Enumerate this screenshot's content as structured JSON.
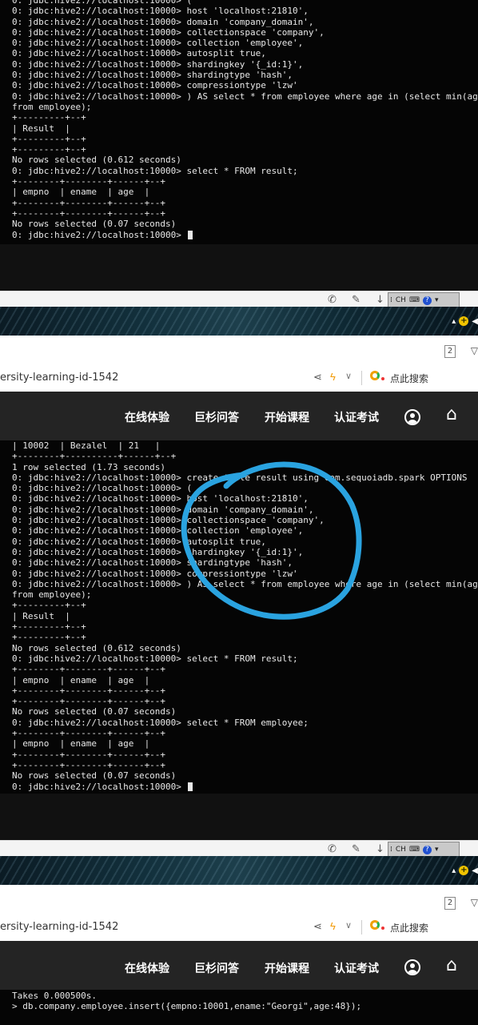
{
  "screenshot_1": {
    "terminal_lines": [
      "0: jdbc:hive2://localhost:10000> (",
      "0: jdbc:hive2://localhost:10000> host 'localhost:21810',",
      "0: jdbc:hive2://localhost:10000> domain 'company_domain',",
      "0: jdbc:hive2://localhost:10000> collectionspace 'company',",
      "0: jdbc:hive2://localhost:10000> collection 'employee',",
      "0: jdbc:hive2://localhost:10000> autosplit true,",
      "0: jdbc:hive2://localhost:10000> shardingkey '{_id:1}',",
      "0: jdbc:hive2://localhost:10000> shardingtype 'hash',",
      "0: jdbc:hive2://localhost:10000> compressiontype 'lzw'",
      "0: jdbc:hive2://localhost:10000> ) AS select * from employee where age in (select min(age)",
      "from employee);",
      "+---------+--+",
      "| Result  |",
      "+---------+--+",
      "+---------+--+",
      "No rows selected (0.612 seconds)",
      "0: jdbc:hive2://localhost:10000> select * FROM result;",
      "+--------+--------+------+--+",
      "| empno  | ename  | age  |",
      "+--------+--------+------+--+",
      "+--------+--------+------+--+",
      "No rows selected (0.07 seconds)",
      "0: jdbc:hive2://localhost:10000> "
    ],
    "taskbar": {
      "ime_lang": "CH",
      "ime_help": "?"
    }
  },
  "screenshot_2": {
    "tab_count": "2",
    "url_fragment": "ersity-learning-id-1542",
    "search_label": "点此搜索",
    "nav_items": [
      "在线体验",
      "巨杉问答",
      "开始课程",
      "认证考试"
    ],
    "terminal_lines": [
      "| 10002  | Bezalel  | 21   |",
      "+--------+----------+------+--+",
      "1 row selected (1.73 seconds)",
      "0: jdbc:hive2://localhost:10000> create table result using com.sequoiadb.spark OPTIONS",
      "0: jdbc:hive2://localhost:10000> (",
      "0: jdbc:hive2://localhost:10000> host 'localhost:21810',",
      "0: jdbc:hive2://localhost:10000> domain 'company_domain',",
      "0: jdbc:hive2://localhost:10000> collectionspace 'company',",
      "0: jdbc:hive2://localhost:10000> collection 'employee',",
      "0: jdbc:hive2://localhost:10000> autosplit true,",
      "0: jdbc:hive2://localhost:10000> shardingkey '{_id:1}',",
      "0: jdbc:hive2://localhost:10000> shardingtype 'hash',",
      "0: jdbc:hive2://localhost:10000> compressiontype 'lzw'",
      "0: jdbc:hive2://localhost:10000> ) AS select * from employee where age in (select min(age)",
      "from employee);",
      "+---------+--+",
      "| Result  |",
      "+---------+--+",
      "+---------+--+",
      "No rows selected (0.612 seconds)",
      "0: jdbc:hive2://localhost:10000> select * FROM result;",
      "+--------+--------+------+--+",
      "| empno  | ename  | age  |",
      "+--------+--------+------+--+",
      "+--------+--------+------+--+",
      "No rows selected (0.07 seconds)",
      "0: jdbc:hive2://localhost:10000> select * FROM employee;",
      "+--------+--------+------+--+",
      "| empno  | ename  | age  |",
      "+--------+--------+------+--+",
      "+--------+--------+------+--+",
      "No rows selected (0.07 seconds)",
      "0: jdbc:hive2://localhost:10000> "
    ],
    "taskbar": {
      "ime_lang": "CH",
      "ime_help": "?"
    }
  },
  "screenshot_3": {
    "tab_count": "2",
    "url_fragment": "ersity-learning-id-1542",
    "search_label": "点此搜索",
    "nav_items": [
      "在线体验",
      "巨杉问答",
      "开始课程",
      "认证考试"
    ],
    "terminal_lines": [
      "Takes 0.000500s.",
      "> db.company.employee.insert({empno:10001,ename:\"Georgi\",age:48});"
    ]
  },
  "colors": {
    "terminal_bg": "#050505",
    "terminal_fg": "#e8e8e8",
    "nav_bg": "#242424",
    "annotation_circle": "#2aa3e0"
  }
}
